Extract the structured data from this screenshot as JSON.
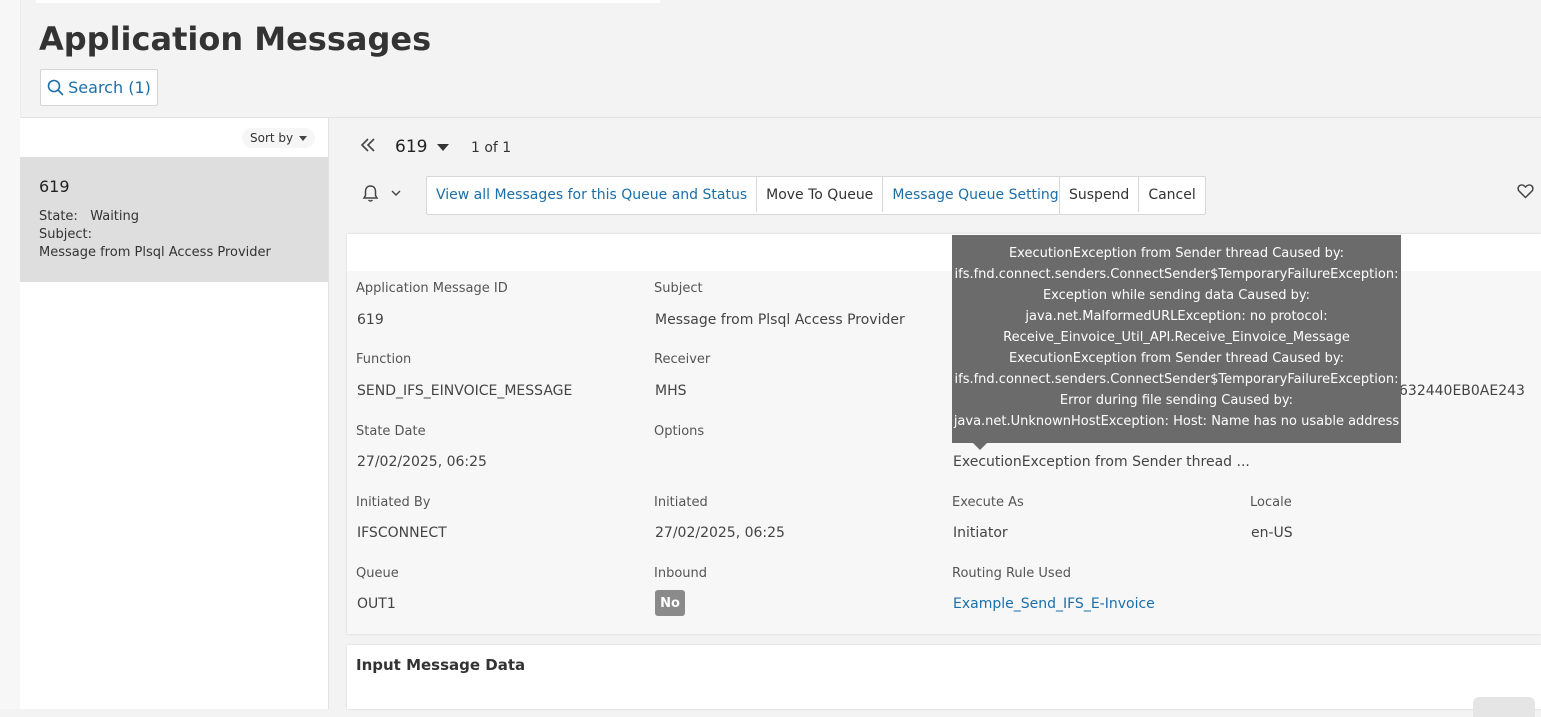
{
  "page": {
    "title": "Application Messages"
  },
  "search": {
    "label": "Search (1)"
  },
  "list": {
    "sort_label": "Sort by",
    "items": [
      {
        "id": "619",
        "state_label": "State:",
        "state_value": "Waiting",
        "subject_label": "Subject:",
        "subject_value": "Message from Plsql Access Provider"
      }
    ]
  },
  "navigator": {
    "record_id": "619",
    "count": "1 of 1"
  },
  "toolbar": {
    "view_all": "View all Messages for this Queue and Status",
    "move_to_queue": "Move To Queue",
    "queue_settings": "Message Queue Settings",
    "suspend": "Suspend",
    "cancel": "Cancel"
  },
  "detail": {
    "app_message_id": {
      "label": "Application Message ID",
      "value": "619"
    },
    "subject": {
      "label": "Subject",
      "value": "Message from Plsql Access Provider"
    },
    "function": {
      "label": "Function",
      "value": "SEND_IFS_EINVOICE_MESSAGE"
    },
    "receiver": {
      "label": "Receiver",
      "value": "MHS"
    },
    "partial_value": "632440EB0AE243",
    "state_date": {
      "label": "State Date",
      "value": "27/02/2025, 06:25"
    },
    "options": {
      "label": "Options",
      "value": ""
    },
    "error_truncated": "ExecutionException from Sender thread ...",
    "initiated_by": {
      "label": "Initiated By",
      "value": "IFSCONNECT"
    },
    "initiated": {
      "label": "Initiated",
      "value": "27/02/2025, 06:25"
    },
    "execute_as": {
      "label": "Execute As",
      "value": "Initiator"
    },
    "locale": {
      "label": "Locale",
      "value": "en-US"
    },
    "queue": {
      "label": "Queue",
      "value": "OUT1"
    },
    "inbound": {
      "label": "Inbound",
      "value": "No"
    },
    "routing_rule": {
      "label": "Routing Rule Used",
      "value": "Example_Send_IFS_E-Invoice"
    }
  },
  "tooltip": {
    "lines": [
      "ExecutionException from Sender thread Caused by:",
      "ifs.fnd.connect.senders.ConnectSender$TemporaryFailureException:",
      "Exception while sending data Caused by:",
      "java.net.MalformedURLException: no protocol:",
      "Receive_Einvoice_Util_API.Receive_Einvoice_Message",
      "ExecutionException from Sender thread Caused by:",
      "ifs.fnd.connect.senders.ConnectSender$TemporaryFailureException:",
      "Error during file sending Caused by:",
      "java.net.UnknownHostException: Host: Name has no usable address"
    ]
  },
  "input_section": {
    "title": "Input Message Data"
  },
  "icons": {
    "search": "search-icon",
    "back": "double-chevron-left-icon",
    "bell": "bell-icon",
    "heart": "heart-icon"
  },
  "colors": {
    "link": "#1a6fa8",
    "tooltip": "#6b6b6b",
    "selected_row": "#dedede",
    "badge": "#8a8a8a"
  }
}
